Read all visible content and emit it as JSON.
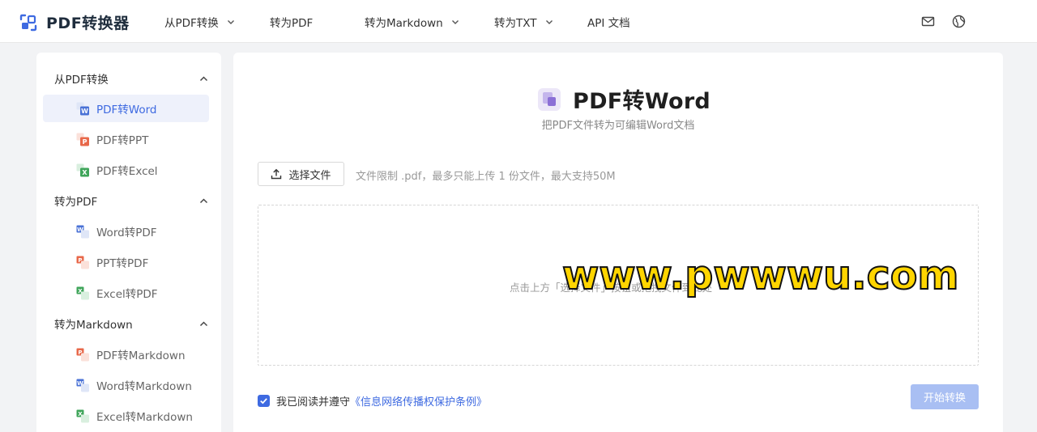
{
  "app": {
    "name": "PDF转换器"
  },
  "nav": [
    {
      "label": "从PDF转换",
      "dropdown": true
    },
    {
      "label": "转为PDF",
      "dropdown": true
    },
    {
      "label": "转为Markdown",
      "dropdown": true
    },
    {
      "label": "转为TXT",
      "dropdown": true
    },
    {
      "label": "API 文档",
      "dropdown": false
    }
  ],
  "header_icons": [
    "mail-icon",
    "globe-icon"
  ],
  "sidebar": {
    "groups": [
      {
        "title": "从PDF转换",
        "items": [
          {
            "label": "PDF转Word",
            "icon": "word-file-icon",
            "active": true
          },
          {
            "label": "PDF转PPT",
            "icon": "ppt-file-icon",
            "active": false
          },
          {
            "label": "PDF转Excel",
            "icon": "excel-file-icon",
            "active": false
          }
        ]
      },
      {
        "title": "转为PDF",
        "items": [
          {
            "label": "Word转PDF",
            "icon": "word-file-icon",
            "active": false
          },
          {
            "label": "PPT转PDF",
            "icon": "ppt-file-icon",
            "active": false
          },
          {
            "label": "Excel转PDF",
            "icon": "excel-file-icon",
            "active": false
          }
        ]
      },
      {
        "title": "转为Markdown",
        "items": [
          {
            "label": "PDF转Markdown",
            "icon": "ppt-file-icon",
            "active": false
          },
          {
            "label": "Word转Markdown",
            "icon": "word-file-icon",
            "active": false
          },
          {
            "label": "Excel转Markdown",
            "icon": "excel-file-icon",
            "active": false
          }
        ]
      }
    ]
  },
  "main": {
    "title": "PDF转Word",
    "subtitle": "把PDF文件转为可编辑Word文档",
    "select_button": "选择文件",
    "limit_text": "文件限制 .pdf，最多只能上传 1 份文件，最大支持50M",
    "drop_hint": "点击上方「选择文件」按钮或拖拽文件到此处",
    "watermark": "www.pwwwu.com",
    "agree_text": "我已阅读并遵守",
    "agree_link": "《信息网络传播权保护条例》",
    "agree_checked": true,
    "start_button": "开始转换"
  },
  "colors": {
    "accent": "#3e6ae1",
    "active_bg": "#eef1fb",
    "start_disabled": "#a9bff3",
    "word": "#4a72d6",
    "ppt": "#e8684a",
    "excel": "#3fa55a"
  }
}
